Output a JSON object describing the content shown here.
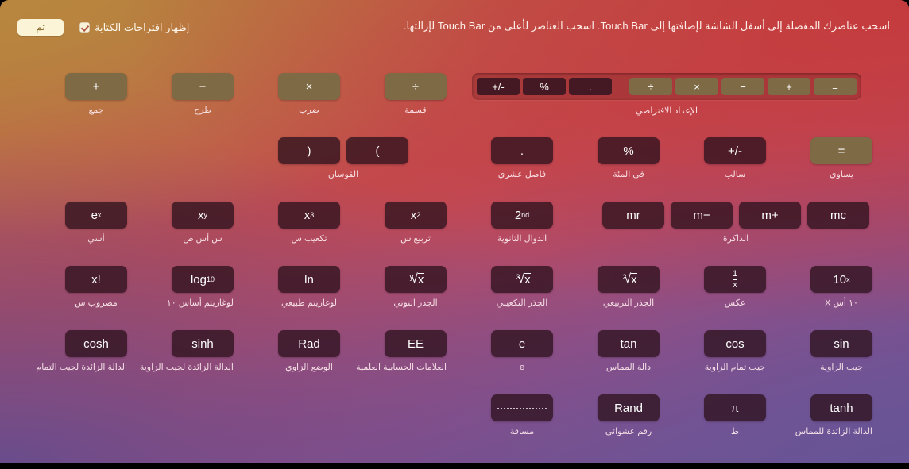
{
  "header": {
    "done_label": "تم",
    "suggestions_label": "إظهار اقتراحات الكتابة",
    "suggestions_checked": true,
    "instructions": "اسحب عناصرك المفضلة إلى أسفل الشاشة لإضافتها إلى Touch Bar. اسحب العناصر لأعلى من Touch Bar لإزالتها."
  },
  "touch_bar": {
    "caption": "الإعداد الافتراضي",
    "keys": [
      {
        "glyph": "=",
        "style": "olive"
      },
      {
        "glyph": "+",
        "style": "olive"
      },
      {
        "glyph": "−",
        "style": "olive"
      },
      {
        "glyph": "×",
        "style": "olive"
      },
      {
        "glyph": "÷",
        "style": "olive"
      },
      {
        "glyph": ".",
        "style": "dark"
      },
      {
        "glyph": "%",
        "style": "dark"
      },
      {
        "glyph": "+/-",
        "style": "dark"
      }
    ]
  },
  "rows": [
    {
      "cells": [
        {
          "glyph": "+",
          "caption": "جمع",
          "style": "olive"
        },
        {
          "glyph": "−",
          "caption": "طرح",
          "style": "olive"
        },
        {
          "glyph": "×",
          "caption": "ضرب",
          "style": "olive"
        },
        {
          "glyph": "÷",
          "caption": "قسمة",
          "style": "olive"
        }
      ]
    },
    {
      "pair": {
        "glyphs": [
          "(",
          ")"
        ],
        "caption": "القوسان",
        "style": "dark"
      },
      "cells": [
        {
          "glyph": ".",
          "caption": "فاصل عشري",
          "style": "dark"
        },
        {
          "glyph": "%",
          "caption": "في المئة",
          "style": "dark"
        },
        {
          "glyph": "+/-",
          "caption": "سالب",
          "style": "dark"
        },
        {
          "glyph": "=",
          "caption": "يساوي",
          "style": "olive"
        }
      ]
    },
    {
      "cells": [
        {
          "glyph": "e^x",
          "caption": "أسي",
          "style": "dark"
        },
        {
          "glyph": "x^y",
          "caption": "س أس ص",
          "style": "dark"
        },
        {
          "glyph": "x^3",
          "caption": "تكعيب س",
          "style": "dark"
        },
        {
          "glyph": "x^2",
          "caption": "تربيع س",
          "style": "dark"
        },
        {
          "glyph": "2nd",
          "caption": "الدوال الثانوية",
          "style": "dark"
        }
      ],
      "memory": {
        "glyphs": [
          "mr",
          "m−",
          "m+",
          "mc"
        ],
        "caption": "الذاكرة",
        "style": "dark"
      }
    },
    {
      "cells": [
        {
          "glyph": "x!",
          "caption": "مضروب س",
          "style": "dark"
        },
        {
          "glyph": "log10",
          "caption": "لوغاريتم أساس ١٠",
          "style": "dark"
        },
        {
          "glyph": "ln",
          "caption": "لوغاريتم طبيعي",
          "style": "dark"
        },
        {
          "glyph": "yroot",
          "caption": "الجذر النوني",
          "style": "dark"
        },
        {
          "glyph": "3root",
          "caption": "الجذر التكعيبي",
          "style": "dark"
        },
        {
          "glyph": "2root",
          "caption": "الجذر التربيعي",
          "style": "dark"
        },
        {
          "glyph": "1/x",
          "caption": "عكس",
          "style": "dark"
        },
        {
          "glyph": "10^x",
          "caption": "١٠ أس X",
          "style": "dark"
        }
      ]
    },
    {
      "cells": [
        {
          "glyph": "cosh",
          "caption": "الدالة الزائدة لجيب التمام",
          "style": "dark"
        },
        {
          "glyph": "sinh",
          "caption": "الدالة الزائدة لجيب الزاوية",
          "style": "dark"
        },
        {
          "glyph": "Rad",
          "caption": "الوضع الزاوي",
          "style": "dark"
        },
        {
          "glyph": "EE",
          "caption": "العلامات الحسابية العلمية",
          "style": "dark"
        },
        {
          "glyph": "e",
          "caption": "e",
          "style": "dark"
        },
        {
          "glyph": "tan",
          "caption": "دالة المماس",
          "style": "dark"
        },
        {
          "glyph": "cos",
          "caption": "جيب تمام الزاوية",
          "style": "dark"
        },
        {
          "glyph": "sin",
          "caption": "جيب الزاوية",
          "style": "dark"
        }
      ]
    },
    {
      "cells": [
        {
          "glyph": "space",
          "caption": "مسافة",
          "style": "dark"
        },
        {
          "glyph": "Rand",
          "caption": "رقم عشوائي",
          "style": "dark"
        },
        {
          "glyph": "π",
          "caption": "ط",
          "style": "dark"
        },
        {
          "glyph": "tanh",
          "caption": "الدالة الزائدة للمماس",
          "style": "dark"
        }
      ]
    }
  ]
}
